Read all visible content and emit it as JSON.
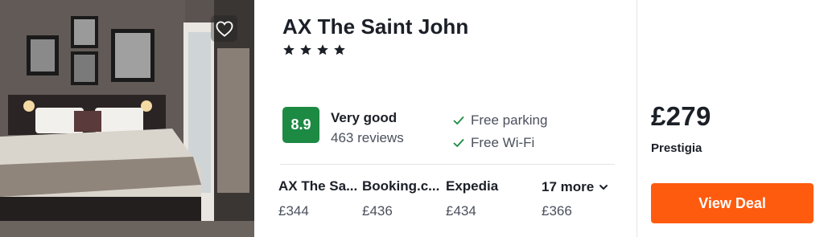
{
  "hotel": {
    "name": "AX The Saint John",
    "stars": 4,
    "rating": {
      "score": "8.9",
      "label": "Very good",
      "reviews": "463 reviews",
      "badge_color": "#1d8a43"
    },
    "amenities": [
      "Free parking",
      "Free Wi-Fi"
    ],
    "icons": {
      "favorite": "heart-icon",
      "star": "star-icon",
      "amenity": "check-icon",
      "more": "chevron-down-icon"
    }
  },
  "providers": [
    {
      "name": "AX The Sa...",
      "price": "£344"
    },
    {
      "name": "Booking.c...",
      "price": "£436"
    },
    {
      "name": "Expedia",
      "price": "£434"
    }
  ],
  "more_deals": {
    "label": "17 more",
    "price": "£366"
  },
  "best_deal": {
    "price": "£279",
    "provider": "Prestigia",
    "button_label": "View Deal",
    "button_color": "#ff5b0f"
  }
}
